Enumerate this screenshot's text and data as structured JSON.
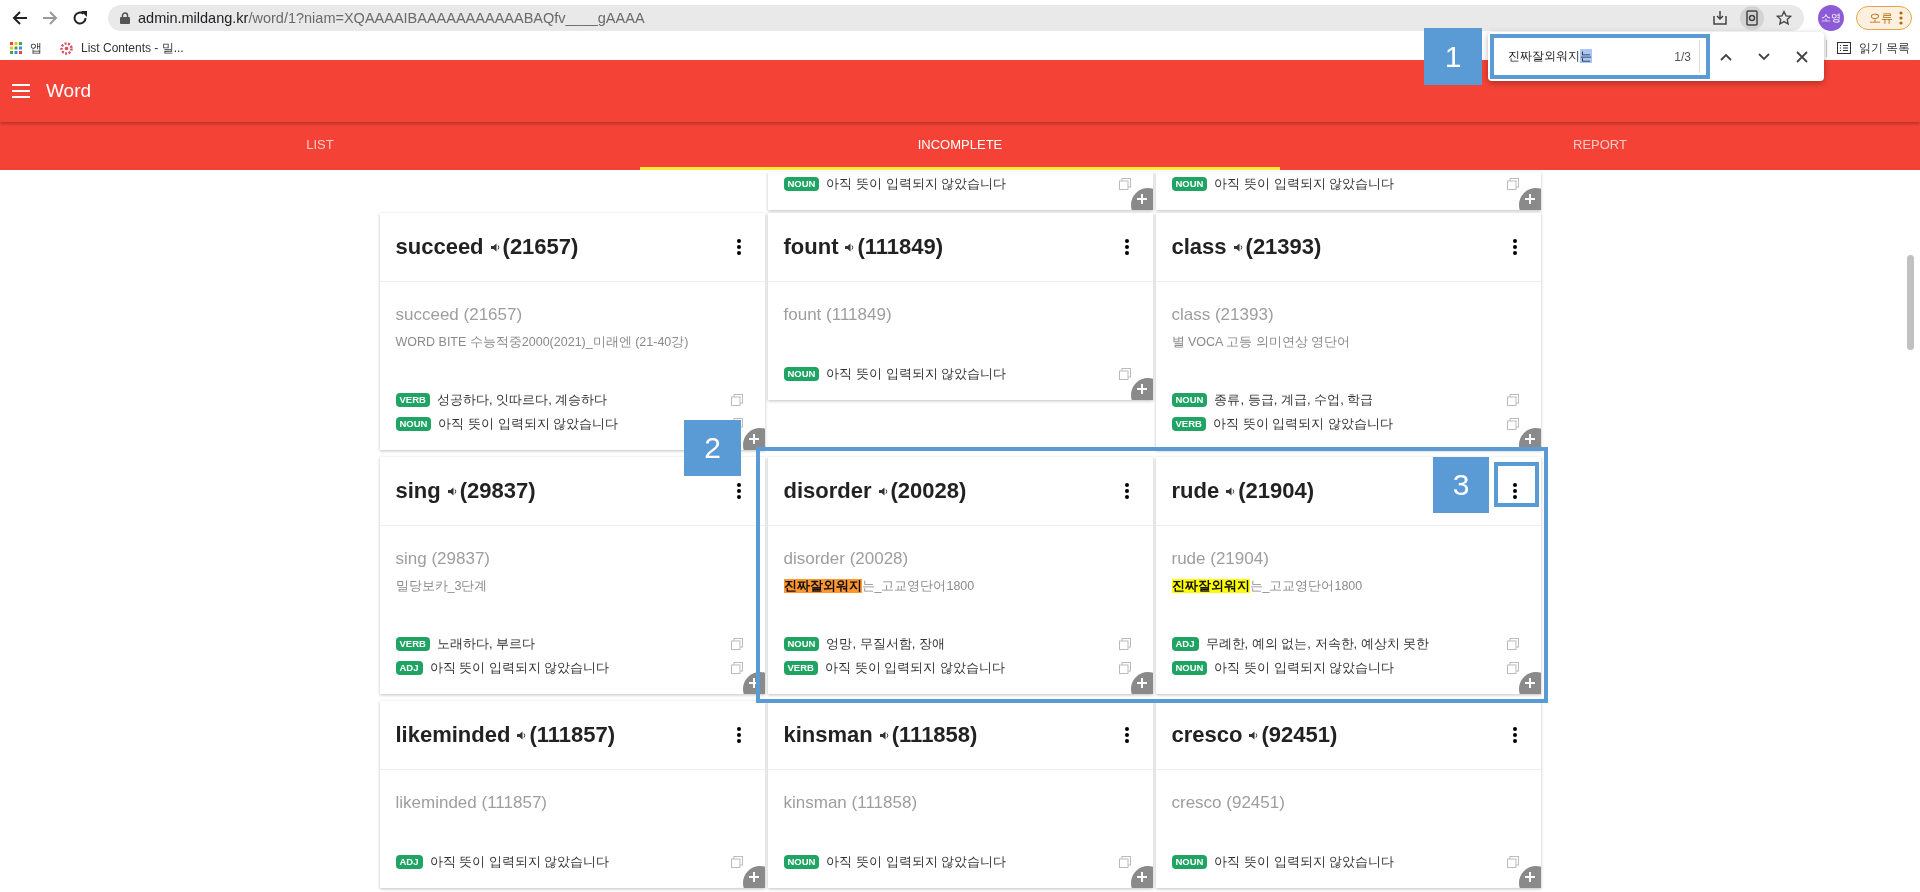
{
  "browser": {
    "url_host": "admin.mildang.kr",
    "url_path": "/word/1?niam=XQAAAAIBAAAAAAAAAAABAQfv____gAAAA",
    "profile": "소영",
    "error_button": "오류"
  },
  "bookmarks": [
    {
      "kind": "apps",
      "label": "앱"
    },
    {
      "kind": "page",
      "label": "List Contents - 밀..."
    }
  ],
  "reading_list": "읽기 목록",
  "find_bar": {
    "query": "진짜잘외워지",
    "query_selected": "는",
    "count": "1/3"
  },
  "app_bar": {
    "title": "Word"
  },
  "tabs": [
    {
      "label": "LIST",
      "selected": false
    },
    {
      "label": "INCOMPLETE",
      "selected": true
    },
    {
      "label": "REPORT",
      "selected": false
    }
  ],
  "columns": [
    [
      {
        "kind": "full",
        "word": "succeed",
        "id": "(21657)",
        "subtitle": "succeed (21657)",
        "source": "WORD BITE 수능적중2000(2021)_미래엔 (21-40강)",
        "meanings": [
          {
            "pos": "VERB",
            "text": "성공하다, 잇따르다, 계승하다"
          },
          {
            "pos": "NOUN",
            "text": "아직 뜻이 입력되지 않았습니다"
          }
        ]
      },
      {
        "kind": "full",
        "word": "sing",
        "id": "(29837)",
        "subtitle": "sing (29837)",
        "source": "밀당보카_3단계",
        "meanings": [
          {
            "pos": "VERB",
            "text": "노래하다, 부르다"
          },
          {
            "pos": "ADJ",
            "text": "아직 뜻이 입력되지 않았습니다"
          }
        ]
      },
      {
        "kind": "full",
        "word": "likeminded",
        "id": "(111857)",
        "subtitle": "likeminded (111857)",
        "meanings": [
          {
            "pos": "ADJ",
            "text": "아직 뜻이 입력되지 않았습니다"
          }
        ]
      }
    ],
    [
      {
        "kind": "partial",
        "meanings": [
          {
            "pos": "NOUN",
            "text": "아직 뜻이 입력되지 않았습니다"
          }
        ]
      },
      {
        "kind": "full",
        "word": "fount",
        "id": "(111849)",
        "subtitle": "fount (111849)",
        "meanings": [
          {
            "pos": "NOUN",
            "text": "아직 뜻이 입력되지 않았습니다"
          }
        ]
      },
      {
        "kind": "full",
        "word": "disorder",
        "id": "(20028)",
        "subtitle": "disorder (20028)",
        "source_match": "진짜잘외워지",
        "source": "는_고교영단어1800",
        "active_match": true,
        "meanings": [
          {
            "pos": "NOUN",
            "text": "엉망, 무질서함, 장애"
          },
          {
            "pos": "VERB",
            "text": "아직 뜻이 입력되지 않았습니다"
          }
        ]
      },
      {
        "kind": "full",
        "word": "kinsman",
        "id": "(111858)",
        "subtitle": "kinsman (111858)",
        "meanings": [
          {
            "pos": "NOUN",
            "text": "아직 뜻이 입력되지 않았습니다"
          }
        ]
      }
    ],
    [
      {
        "kind": "partial",
        "meanings": [
          {
            "pos": "NOUN",
            "text": "아직 뜻이 입력되지 않았습니다"
          }
        ]
      },
      {
        "kind": "full",
        "word": "class",
        "id": "(21393)",
        "subtitle": "class (21393)",
        "source": "별 VOCA 고등 의미연상 영단어",
        "meanings": [
          {
            "pos": "NOUN",
            "text": "종류, 등급, 계급, 수업, 학급"
          },
          {
            "pos": "VERB",
            "text": "아직 뜻이 입력되지 않았습니다"
          }
        ]
      },
      {
        "kind": "full",
        "word": "rude",
        "id": "(21904)",
        "subtitle": "rude (21904)",
        "source_match": "진짜잘외워지",
        "source": "는_고교영단어1800",
        "active_match": false,
        "meanings": [
          {
            "pos": "ADJ",
            "text": "무례한, 예의 없는, 저속한, 예상치 못한"
          },
          {
            "pos": "NOUN",
            "text": "아직 뜻이 입력되지 않았습니다"
          }
        ]
      },
      {
        "kind": "full",
        "word": "cresco",
        "id": "(92451)",
        "subtitle": "cresco (92451)",
        "meanings": [
          {
            "pos": "NOUN",
            "text": "아직 뜻이 입력되지 않았습니다"
          }
        ]
      }
    ]
  ],
  "annotations": [
    {
      "label": "1"
    },
    {
      "label": "2"
    },
    {
      "label": "3"
    }
  ]
}
